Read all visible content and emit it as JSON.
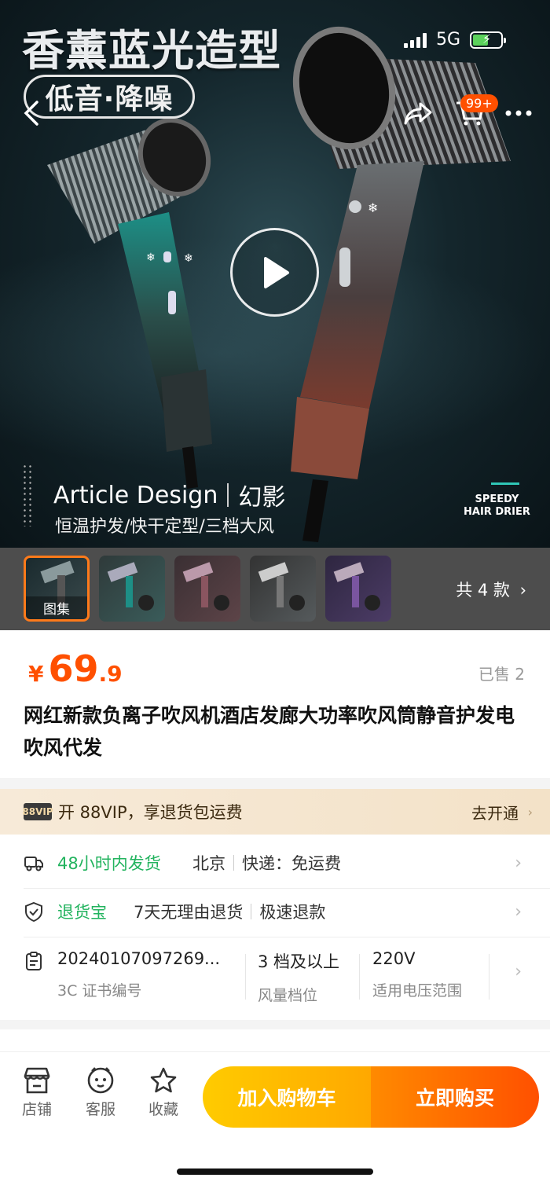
{
  "status_bar": {
    "network": "5G"
  },
  "hero": {
    "title": "香薰蓝光造型",
    "badge": "低音·降噪",
    "article_design": "Article Design",
    "article_design_cn": "幻影",
    "slogan": "恒温护发/快干定型/三档大风",
    "speedy_line1": "SPEEDY",
    "speedy_line2": "HAIR DRIER",
    "cart_count": "99+"
  },
  "thumbnails": {
    "gallery_label": "图集",
    "variant_count": "共 4 款",
    "colors": [
      "#3a5c5a",
      "#5d4448",
      "#555a5c",
      "#4c3c66"
    ]
  },
  "product": {
    "currency": "¥",
    "price_int": "69",
    "price_dec": ".9",
    "sold": "已售 2",
    "title": "网红新款负离子吹风机酒店发廊大功率吹风筒静音护发电吹风代发"
  },
  "vip": {
    "logo": "88VIP",
    "text": "开 88VIP，享退货包运费",
    "cta": "去开通"
  },
  "shipping": {
    "time": "48小时内发货",
    "origin": "北京",
    "express": "快递：免运费"
  },
  "returns": {
    "name": "退货宝",
    "policy": "7天无理由退货",
    "refund": "极速退款"
  },
  "specs": [
    {
      "value": "20240107097269...",
      "label": "3C 证书编号"
    },
    {
      "value": "3 档及以上",
      "label": "风量档位"
    },
    {
      "value": "220V",
      "label": "适用电压范围"
    }
  ],
  "bottom_bar": {
    "store": "店铺",
    "service": "客服",
    "favorite": "收藏",
    "add_to_cart": "加入购物车",
    "buy_now": "立即购买"
  },
  "colors": {
    "accent_orange": "#ff5000",
    "accent_green": "#22b35e",
    "cart_yellow": "#ffb400"
  }
}
